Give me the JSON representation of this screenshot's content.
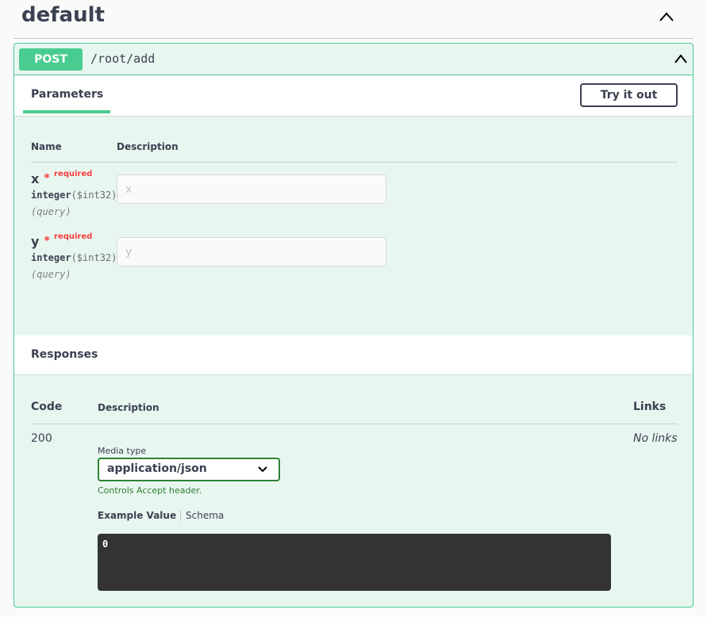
{
  "section": {
    "title": "default"
  },
  "operation": {
    "method": "POST",
    "path": "/root/add",
    "method_color": "#49cc90"
  },
  "parameters": {
    "tab_label": "Parameters",
    "try_button_label": "Try it out",
    "col_name": "Name",
    "col_description": "Description",
    "items": [
      {
        "name": "x",
        "required": "required",
        "type": "integer",
        "format": "($int32)",
        "in": "(query)",
        "placeholder": "x"
      },
      {
        "name": "y",
        "required": "required",
        "type": "integer",
        "format": "($int32)",
        "in": "(query)",
        "placeholder": "y"
      }
    ]
  },
  "responses": {
    "title": "Responses",
    "col_code": "Code",
    "col_description": "Description",
    "col_links": "Links",
    "rows": [
      {
        "code": "200",
        "links": "No links",
        "media_type_label": "Media type",
        "media_type_value": "application/json",
        "accept_note": "Controls Accept header.",
        "example_tab": "Example Value",
        "schema_tab": "Schema",
        "example_body": "0"
      }
    ]
  }
}
